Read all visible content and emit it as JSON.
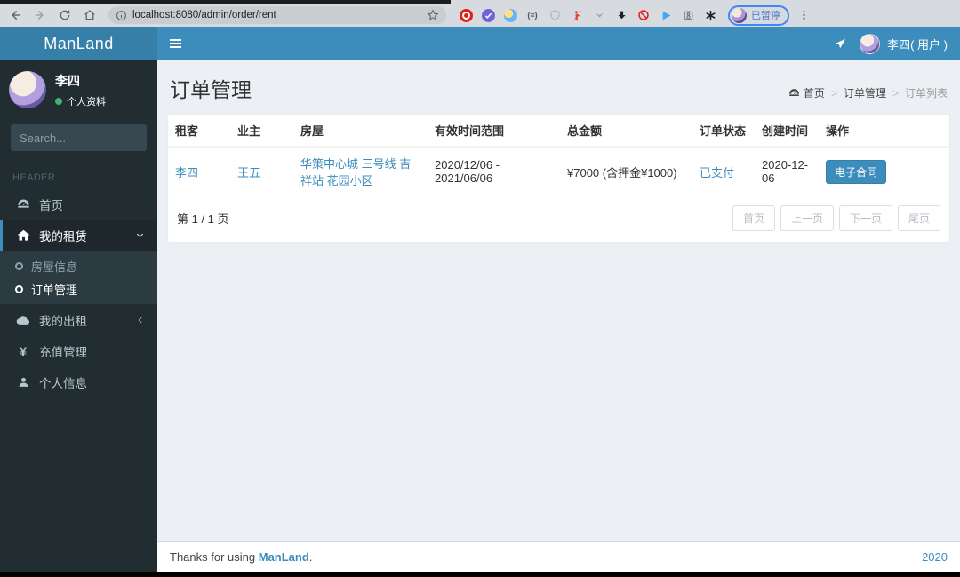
{
  "browser": {
    "url": "localhost:8080/admin/order/rent",
    "profile_badge": "已暂停",
    "extension_icons": [
      "opera-red-icon",
      "purple-check-icon",
      "pen-blue-icon",
      "brackets-icon",
      "shield-gray-icon",
      "runner-red-icon",
      "chevron-gray-icon",
      "download-black-icon",
      "blocker-red-icon",
      "play-blue-icon",
      "square-gray-icon",
      "asterisk-black-icon"
    ]
  },
  "navbar": {
    "brand": "ManLand",
    "user_label": "李四( 用户 )"
  },
  "sidebar": {
    "user_name": "李四",
    "user_status": "个人资料",
    "search_placeholder": "Search...",
    "section_header": "HEADER",
    "menu": [
      {
        "label": "首页"
      },
      {
        "label": "我的租赁",
        "children": [
          {
            "label": "房屋信息"
          },
          {
            "label": "订单管理"
          }
        ]
      },
      {
        "label": "我的出租"
      },
      {
        "label": "充值管理",
        "icon_glyph": "¥"
      },
      {
        "label": "个人信息"
      }
    ]
  },
  "content": {
    "title": "订单管理",
    "breadcrumb": [
      "首页",
      "订单管理",
      "订单列表"
    ],
    "table": {
      "headers": [
        "租客",
        "业主",
        "房屋",
        "有效时间范围",
        "总金额",
        "订单状态",
        "创建时间",
        "操作"
      ],
      "rows": [
        {
          "tenant": "李四",
          "owner": "王五",
          "house": "华策中心城 三号线 吉祥站 花园小区",
          "valid_range": "2020/12/06 - 2021/06/06",
          "amount": "¥7000 (含押金¥1000)",
          "status": "已支付",
          "created": "2020-12-06",
          "action": "电子合同"
        }
      ]
    },
    "pagination": {
      "info": "第 1 / 1 页",
      "buttons": [
        "首页",
        "上一页",
        "下一页",
        "尾页"
      ]
    }
  },
  "footer": {
    "text_prefix": "Thanks for using",
    "brand": "ManLand",
    "text_suffix": ".",
    "year": "2020"
  },
  "colors": {
    "navbar_blue": "#3c8dbc",
    "brand_blue_dark": "#367fa9",
    "sidebar_dark": "#222d32",
    "submenu_dark": "#2c3b41",
    "content_bg": "#ecf0f5",
    "link_blue": "#3c8dbc",
    "status_green": "#3cb371"
  }
}
